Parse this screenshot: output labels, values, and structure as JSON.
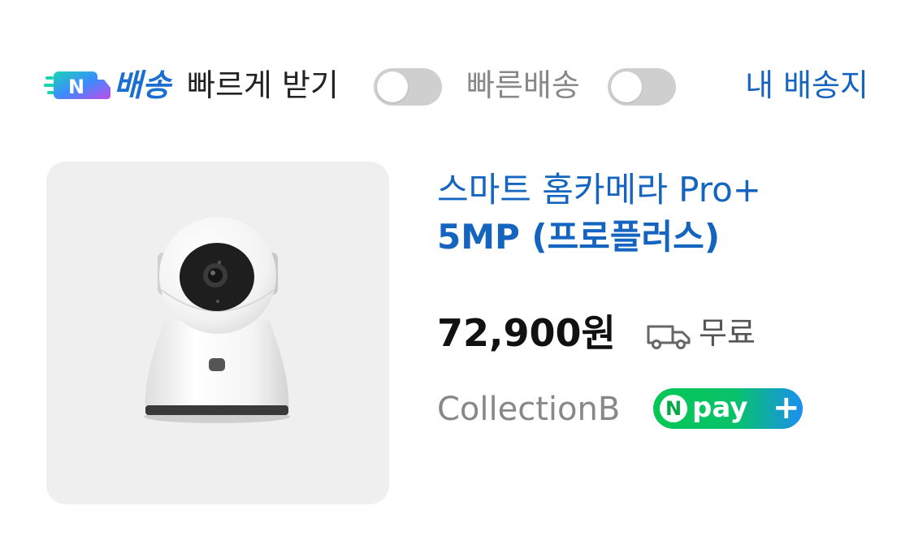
{
  "filters": {
    "n_delivery_label": "배송",
    "fast_receive_label": "빠르게 받기",
    "fast_receive_on": false,
    "quick_delivery_label": "빠른배송",
    "quick_delivery_on": false,
    "my_address_link": "내 배송지",
    "n_badge_letter": "N"
  },
  "product": {
    "title_line1": "스마트 홈카메라 Pro+",
    "title_line2": "5MP (프로플러스)",
    "price": "72,900원",
    "shipping": "무료",
    "seller": "CollectionB",
    "npay": {
      "n": "N",
      "text": "pay",
      "plus": "+"
    }
  },
  "colors": {
    "link_blue": "#1565c0",
    "toggle_off": "#cfcfcf",
    "npay_green": "#06c755",
    "npay_blue": "#1a8ff0"
  },
  "icons": {
    "n_delivery": "n-delivery-truck-icon",
    "truck": "delivery-truck-icon"
  }
}
